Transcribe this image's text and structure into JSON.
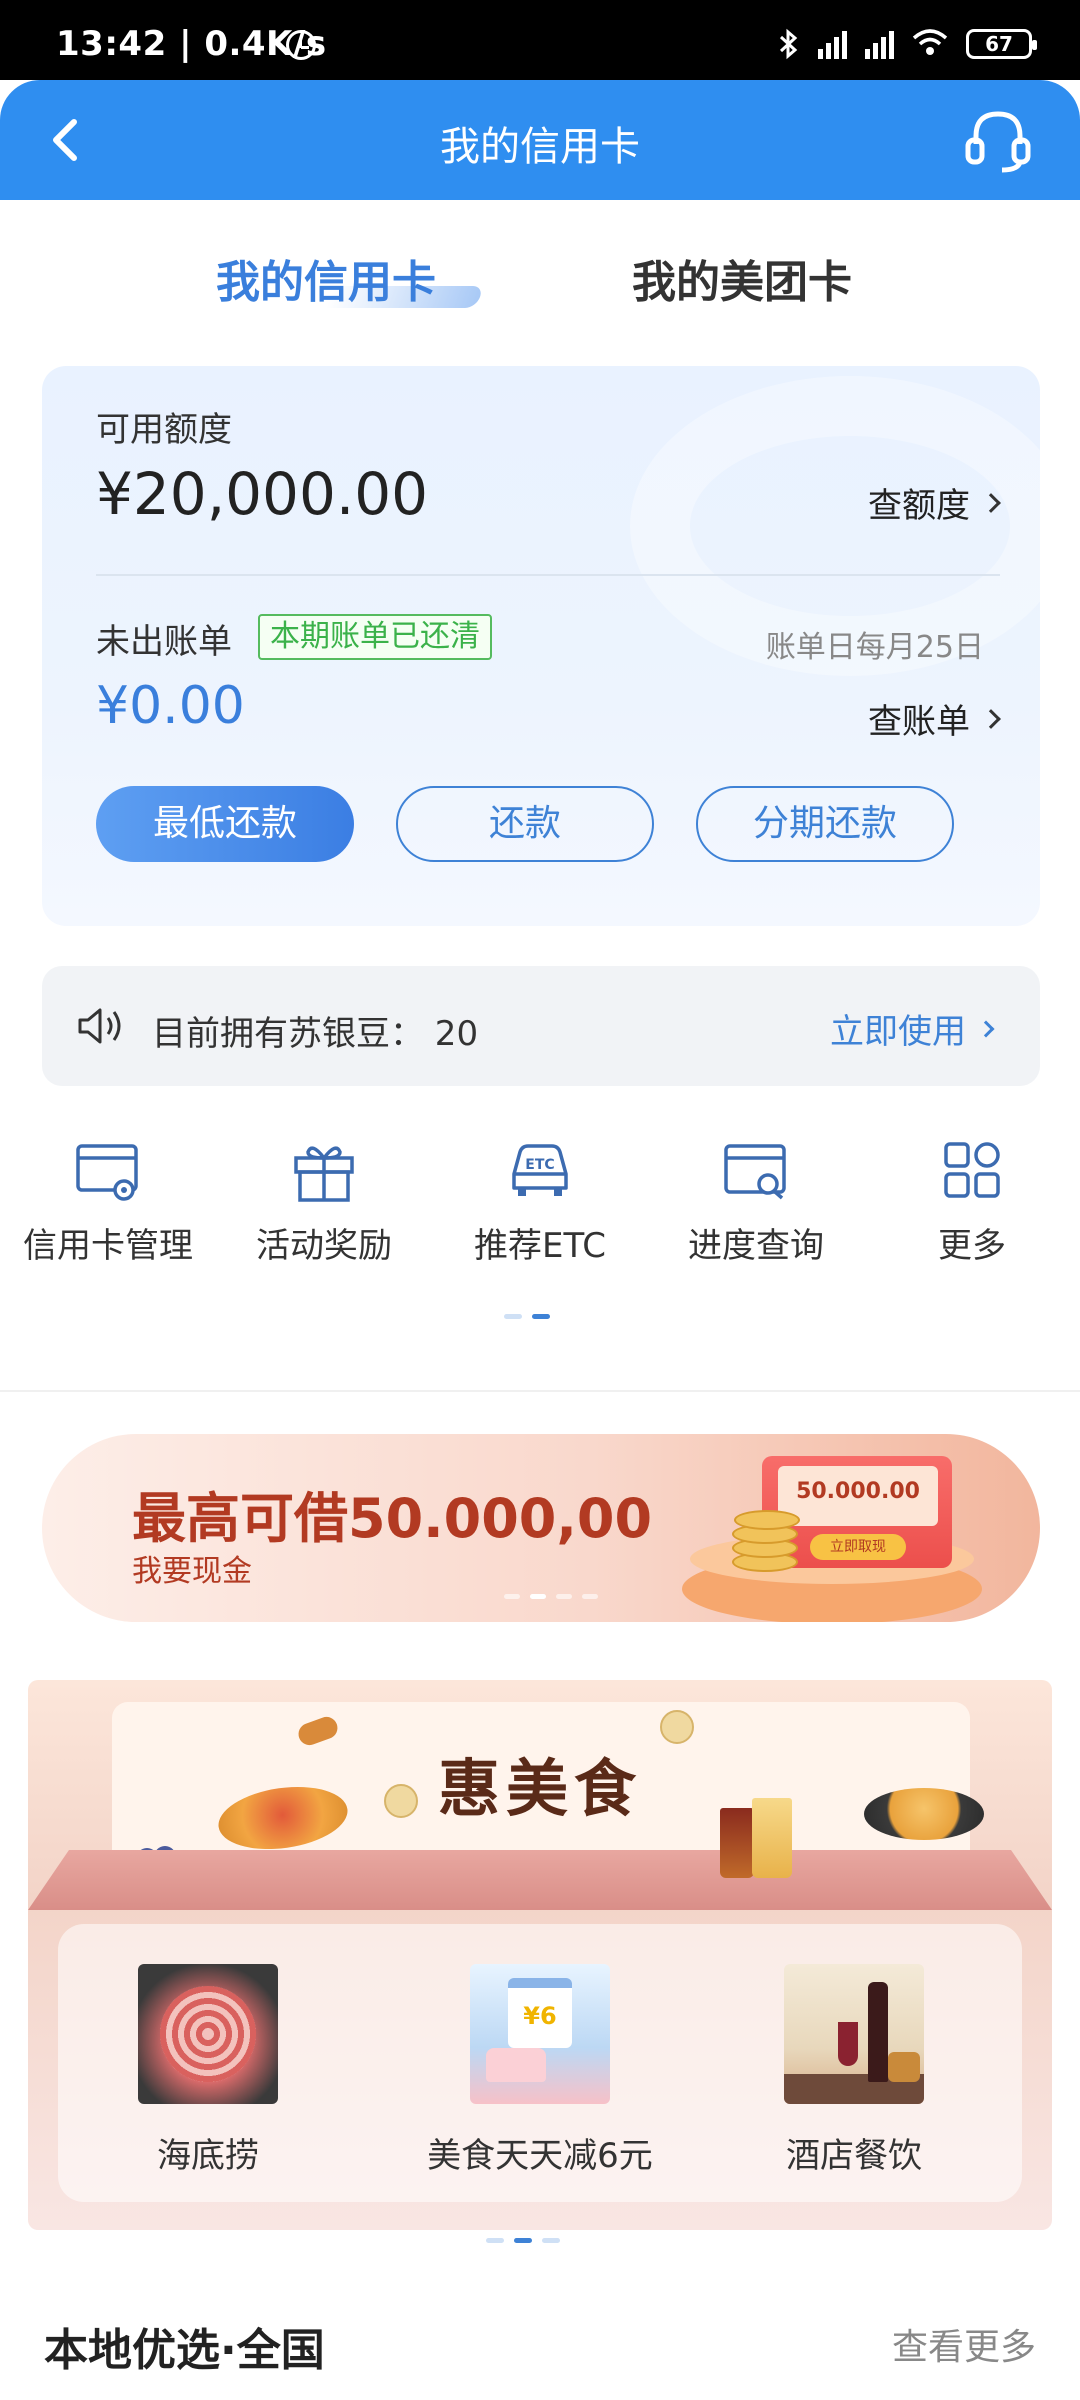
{
  "status_bar": {
    "time_net": "13:42 | 0.4K/s",
    "battery": "67"
  },
  "header": {
    "title": "我的信用卡"
  },
  "tabs": [
    {
      "label": "我的信用卡",
      "active": true
    },
    {
      "label": "我的美团卡",
      "active": false
    }
  ],
  "card": {
    "available_label": "可用额度",
    "available_amount": "¥20,000.00",
    "view_limit": "查额度",
    "unbilled_label": "未出账单",
    "paid_badge": "本期账单已还清",
    "bill_day": "账单日每月25日",
    "unbilled_amount": "¥0.00",
    "view_bill": "查账单",
    "buttons": [
      "最低还款",
      "还款",
      "分期还款"
    ]
  },
  "beans": {
    "text": "目前拥有苏银豆：  20",
    "action": "立即使用"
  },
  "quick_actions": [
    {
      "label": "信用卡管理",
      "icon": "card-settings-icon"
    },
    {
      "label": "活动奖励",
      "icon": "gift-icon"
    },
    {
      "label": "推荐ETC",
      "icon": "etc-car-icon"
    },
    {
      "label": "进度查询",
      "icon": "progress-search-icon"
    },
    {
      "label": "更多",
      "icon": "more-grid-icon"
    }
  ],
  "loan_banner": {
    "title": "最高可借50.000,00",
    "subtitle": "我要现金",
    "envelope_amount": "50.000.00",
    "envelope_button": "立即取现"
  },
  "food_section": {
    "title": "惠美食",
    "items": [
      {
        "label": "海底捞"
      },
      {
        "label": "美食天天减6元",
        "calendar_text": "¥6"
      },
      {
        "label": "酒店餐饮"
      }
    ]
  },
  "local": {
    "title": "本地优选·全国",
    "more": "查看更多"
  },
  "colors": {
    "primary": "#2f8ef0",
    "accent_blue": "#3e82d6",
    "badge_green": "#3bb24a",
    "loan_red": "#b23a22"
  }
}
